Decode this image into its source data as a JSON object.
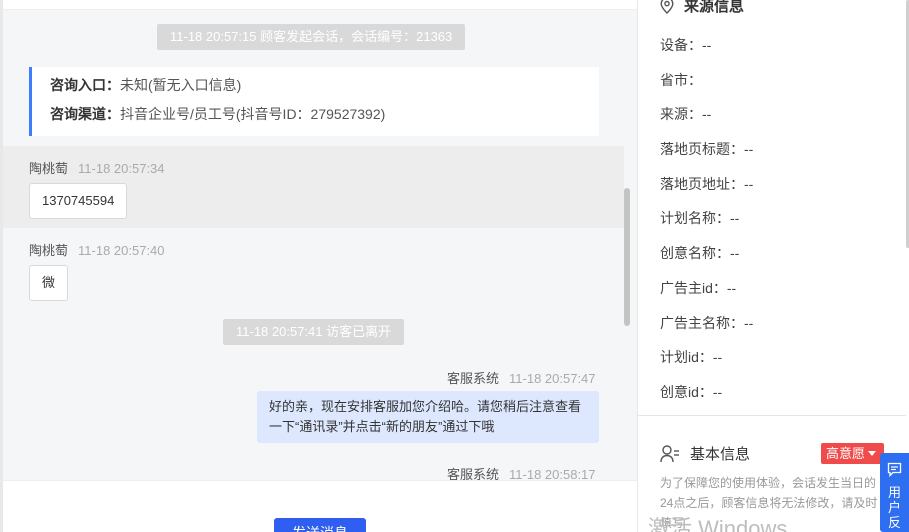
{
  "chat": {
    "session_start": "11-18 20:57:15 顾客发起会话，会话编号：21363",
    "consult_entry_label": "咨询入口：",
    "consult_entry_value": "未知(暂无入口信息)",
    "consult_channel_label": "咨询渠道：",
    "consult_channel_value": "抖音企业号/员工号(抖音号ID：279527392)",
    "messages": [
      {
        "sender": "陶桃萄",
        "time": "11-18 20:57:34",
        "text": "1370745594"
      },
      {
        "sender": "陶桃萄",
        "time": "11-18 20:57:40",
        "text": "微"
      }
    ],
    "visitor_left": "11-18 20:57:41 访客已离开",
    "system_reply": {
      "sender": "客服系统",
      "time": "11-18 20:57:47",
      "text": "好的亲，现在安排客服加您介绍哈。请您稍后注意查看一下“通讯录”并点击“新的朋友”通过下哦"
    },
    "system_partial": {
      "sender": "客服系统",
      "time": "11-18 20:58:17"
    },
    "send_button": "发送消息"
  },
  "right_panel": {
    "source_title": "来源信息",
    "fields": [
      "设备：--",
      "省市：",
      "来源：--",
      "落地页标题：--",
      "落地页地址：--",
      "计划名称：--",
      "创意名称：--",
      "广告主id：--",
      "广告主名称：--",
      "计划id：--",
      "创意id：--"
    ],
    "basic_title": "基本信息",
    "intent_badge": "高意愿",
    "notice": "为了保障您的使用体验，会话发生当日的24点之后，顾客信息将无法修改，请及时填写",
    "watermark": "激活 Windows",
    "feedback": "用户反"
  },
  "colors": {
    "accent": "#3d7eff",
    "send_button": "#2e5ff0",
    "badge": "#f04b4b",
    "outgoing_bubble": "#dde8ff"
  }
}
